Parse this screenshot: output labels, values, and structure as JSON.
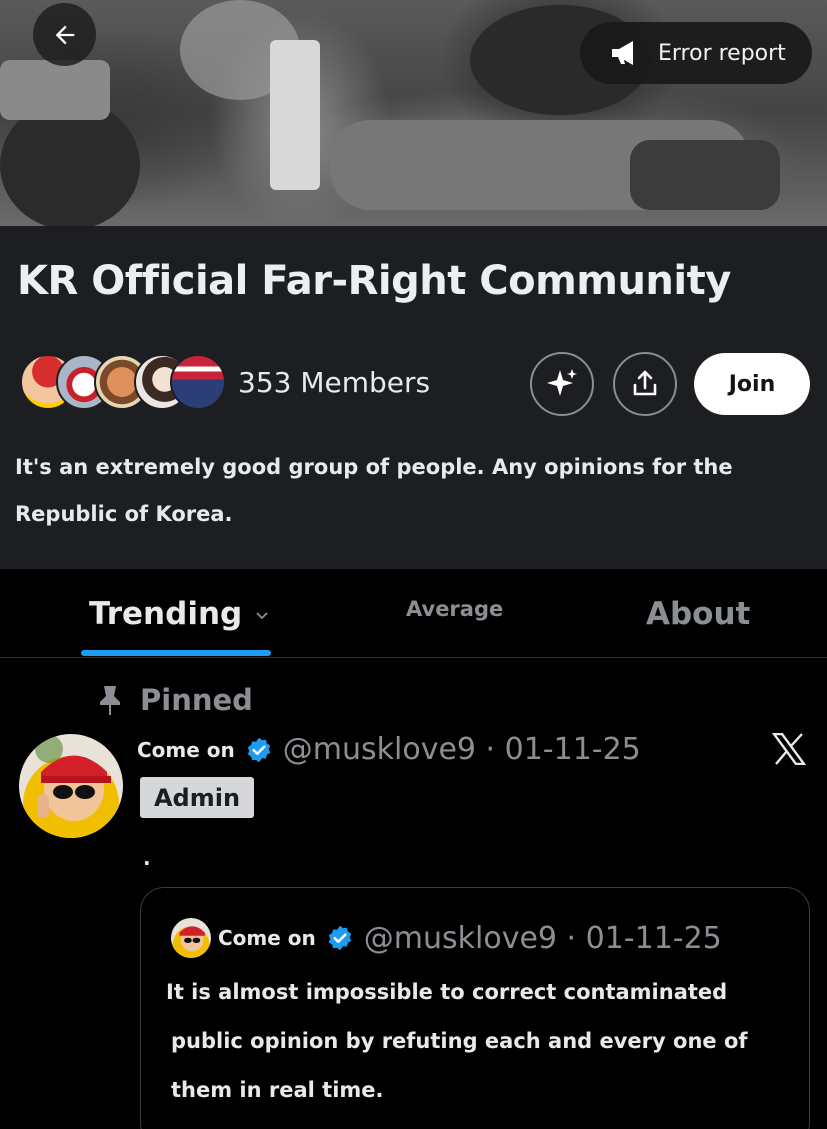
{
  "banner": {
    "back_icon": "arrow-left-icon",
    "report": {
      "icon": "megaphone-icon",
      "label": "Error report"
    }
  },
  "community": {
    "title": "KR Official Far-Right Community",
    "members": "353 Members",
    "join_label": "Join",
    "actions": [
      {
        "icon": "sparkle-icon"
      },
      {
        "icon": "share-icon"
      }
    ],
    "description": "It's an extremely good group of people. Any opinions for the Republic of Korea."
  },
  "tabs": [
    {
      "label": "Trending",
      "active": true
    },
    {
      "label": "Average",
      "active": false
    },
    {
      "label": "About",
      "active": false
    }
  ],
  "post": {
    "pinned_label": "Pinned",
    "author": "Come on",
    "handle": "@musklove9 · 01-11-25",
    "badge": "Admin",
    "body": ".",
    "quote": {
      "author": "Come on",
      "handle": "@musklove9 · 01-11-25",
      "lines": [
        "It is almost impossible to correct contaminated",
        "public opinion by refuting each and every one of",
        "them in real time."
      ]
    }
  },
  "colors": {
    "accent": "#1d9bf0",
    "header_bg": "#1c1e22",
    "muted": "#8b8f94"
  }
}
